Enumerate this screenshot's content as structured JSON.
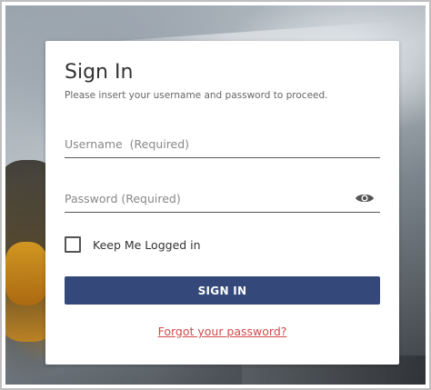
{
  "login": {
    "title": "Sign In",
    "subtitle": "Please insert your username and password to proceed.",
    "username": {
      "value": "",
      "placeholder": "Username  (Required)"
    },
    "password": {
      "value": "",
      "placeholder": "Password (Required)",
      "toggle_icon": "eye-icon"
    },
    "remember": {
      "label": "Keep Me Logged in",
      "checked": false
    },
    "submit_label": "SIGN IN",
    "forgot_label": "Forgot your password?"
  },
  "colors": {
    "primary_button": "#34497a",
    "link": "#d24a4a",
    "text": "#333333",
    "muted_text": "#666666"
  }
}
